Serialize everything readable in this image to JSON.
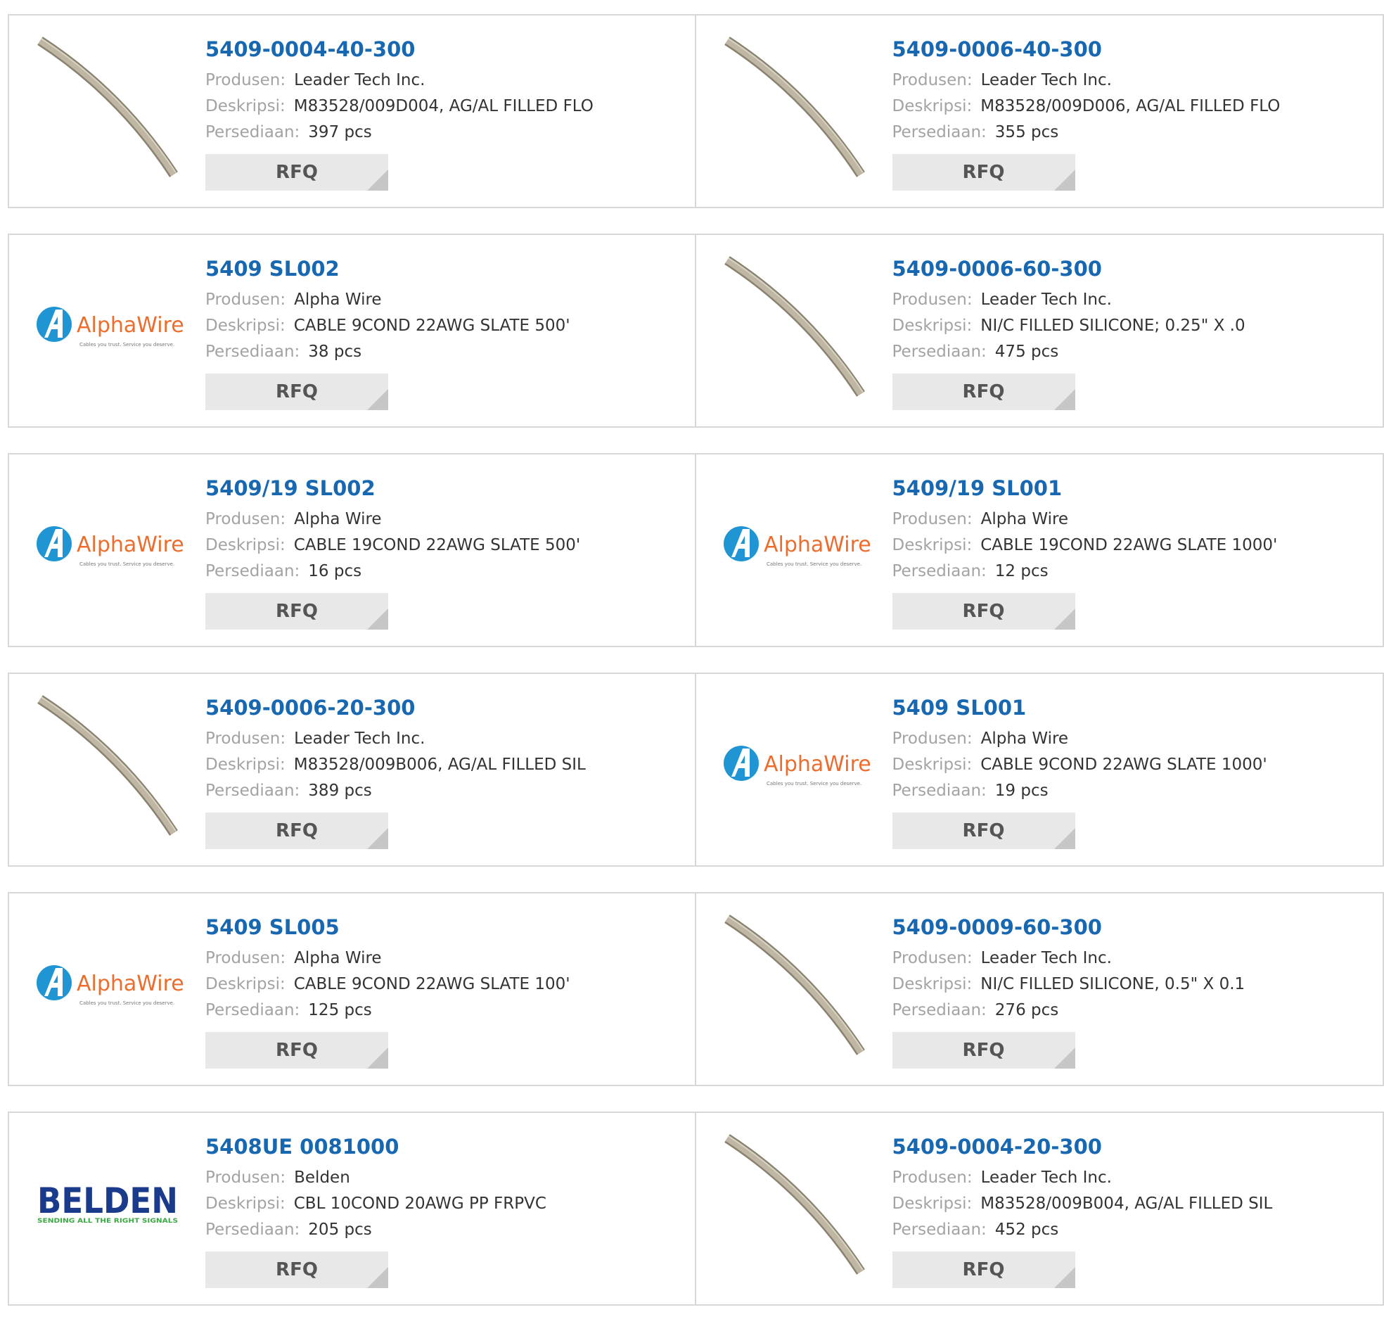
{
  "labels": {
    "manufacturer": "Produsen:",
    "description": "Deskripsi:",
    "stock": "Persediaan:",
    "rfq": "RFQ"
  },
  "logos": {
    "alphawire_name": "AlphaWire",
    "alphawire_tagline": "Cables you trust. Service you deserve.",
    "belden_name": "BELDEN",
    "belden_tagline": "SENDING ALL THE RIGHT SIGNALS"
  },
  "colors": {
    "part_link": "#1767b1",
    "label": "#a3a3a3",
    "value": "#333333",
    "rfq_bg": "#e8e8e8",
    "border": "#d7d7d7"
  },
  "products": [
    {
      "part": "5409-0004-40-300",
      "manufacturer": "Leader Tech Inc.",
      "description": "M83528/009D004, AG/AL FILLED FLO",
      "stock": "397 pcs",
      "image": "tube-icon"
    },
    {
      "part": "5409-0006-40-300",
      "manufacturer": "Leader Tech Inc.",
      "description": "M83528/009D006, AG/AL FILLED FLO",
      "stock": "355 pcs",
      "image": "tube-icon"
    },
    {
      "part": "5409 SL002",
      "manufacturer": "Alpha Wire",
      "description": "CABLE 9COND 22AWG SLATE 500'",
      "stock": "38 pcs",
      "image": "alphawire-logo"
    },
    {
      "part": "5409-0006-60-300",
      "manufacturer": "Leader Tech Inc.",
      "description": "NI/C FILLED SILICONE; 0.25\" X .0",
      "stock": "475 pcs",
      "image": "tube-icon"
    },
    {
      "part": "5409/19 SL002",
      "manufacturer": "Alpha Wire",
      "description": "CABLE 19COND 22AWG SLATE 500'",
      "stock": "16 pcs",
      "image": "alphawire-logo"
    },
    {
      "part": "5409/19 SL001",
      "manufacturer": "Alpha Wire",
      "description": "CABLE 19COND 22AWG SLATE 1000'",
      "stock": "12 pcs",
      "image": "alphawire-logo"
    },
    {
      "part": "5409-0006-20-300",
      "manufacturer": "Leader Tech Inc.",
      "description": "M83528/009B006, AG/AL FILLED SIL",
      "stock": "389 pcs",
      "image": "tube-icon"
    },
    {
      "part": "5409 SL001",
      "manufacturer": "Alpha Wire",
      "description": "CABLE 9COND 22AWG SLATE 1000'",
      "stock": "19 pcs",
      "image": "alphawire-logo"
    },
    {
      "part": "5409 SL005",
      "manufacturer": "Alpha Wire",
      "description": "CABLE 9COND 22AWG SLATE 100'",
      "stock": "125 pcs",
      "image": "alphawire-logo"
    },
    {
      "part": "5409-0009-60-300",
      "manufacturer": "Leader Tech Inc.",
      "description": "NI/C FILLED SILICONE, 0.5\" X 0.1",
      "stock": "276 pcs",
      "image": "tube-icon"
    },
    {
      "part": "5408UE 0081000",
      "manufacturer": "Belden",
      "description": "CBL 10COND 20AWG PP FRPVC",
      "stock": "205 pcs",
      "image": "belden-logo"
    },
    {
      "part": "5409-0004-20-300",
      "manufacturer": "Leader Tech Inc.",
      "description": "M83528/009B004, AG/AL FILLED SIL",
      "stock": "452 pcs",
      "image": "tube-icon"
    }
  ]
}
